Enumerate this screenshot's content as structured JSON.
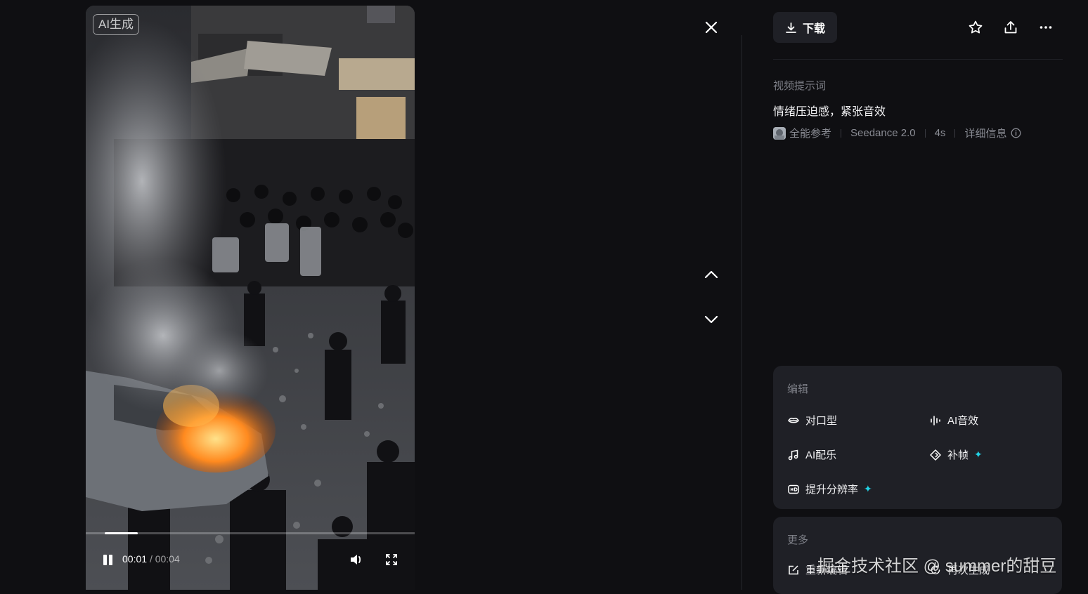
{
  "video": {
    "badge": "AI生成",
    "current_time": "00:01",
    "time_separator": "/",
    "total_time": "00:04",
    "progress_fraction": 0.2
  },
  "panel": {
    "download_label": "下载",
    "prompt_label": "视频提示词",
    "prompt_text": "情绪压迫感，紧张音效",
    "reference_label": "全能参考",
    "model": "Seedance 2.0",
    "duration": "4s",
    "details_label": "详细信息"
  },
  "edit": {
    "title": "编辑",
    "tools": {
      "lipsync": "对口型",
      "ai_sfx": "AI音效",
      "ai_music": "AI配乐",
      "frame_interp": "补帧",
      "upscale": "提升分辨率"
    }
  },
  "more": {
    "title": "更多",
    "reedit": "重新编辑",
    "regenerate": "再次生成"
  },
  "watermark": "掘金技术社区 @ summer的甜豆",
  "colors": {
    "accent_spark": "#22d3e6",
    "panel_card": "#1f2026",
    "background": "#0f0f12"
  }
}
